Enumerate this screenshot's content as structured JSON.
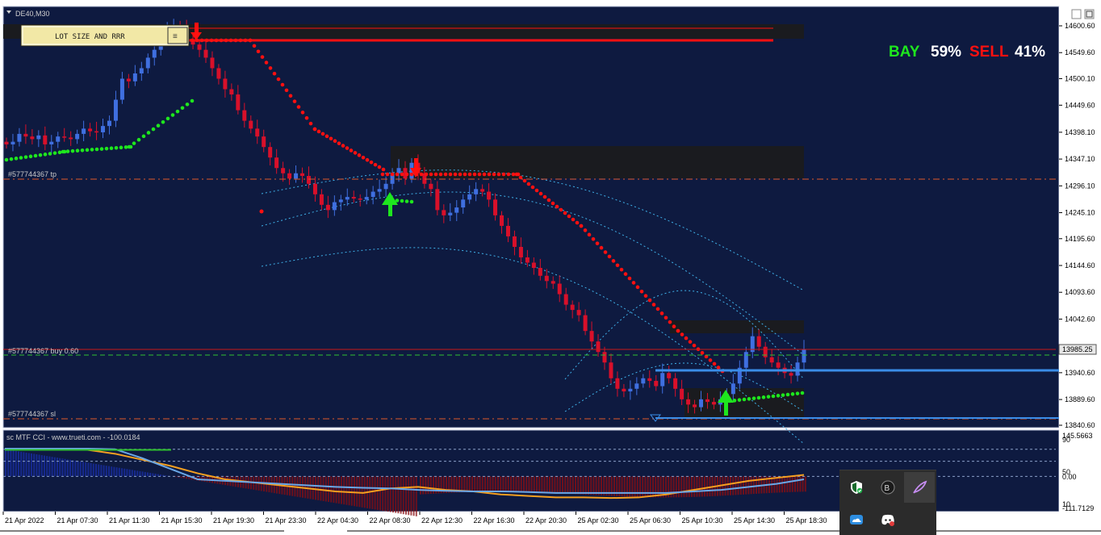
{
  "window": {
    "title": "DE40,M30"
  },
  "panel": {
    "lot_size_label": "LOT SIZE AND RRR"
  },
  "sentiment": {
    "buy_label": "BAY",
    "buy_pct": "59%",
    "sell_label": "SELL",
    "sell_pct": "41%"
  },
  "order_lines": {
    "tp": "#577744367 tp",
    "buy": "#577744367 buy 0.60",
    "sl": "#577744367 sl"
  },
  "current_price": "13985.25",
  "indicator": {
    "label": "sc MTF CCI - www.trueti.com - -100.0184"
  },
  "colors": {
    "background": "#0e1a40",
    "bull": "#3f6fe0",
    "bear": "#d8102a",
    "trail_up": "#1ee61e",
    "trail_down": "#ff1010",
    "zone": "#1c1c1c",
    "buy_text": "#1ee61e",
    "sell_text": "#ff1010"
  },
  "chart_data": [
    {
      "type": "candlestick",
      "symbol": "DE40",
      "timeframe": "M30",
      "ylim": [
        13815,
        14625
      ],
      "y_ticks": [
        "14600.60",
        "14549.60",
        "14500.10",
        "14449.60",
        "14398.10",
        "14347.10",
        "14296.10",
        "14245.10",
        "14195.60",
        "14144.60",
        "14093.60",
        "14042.60",
        "13940.60",
        "13889.60",
        "13840.60"
      ],
      "x_ticks": [
        "21 Apr 2022",
        "21 Apr 07:30",
        "21 Apr 11:30",
        "21 Apr 15:30",
        "21 Apr 19:30",
        "21 Apr 23:30",
        "22 Apr 04:30",
        "22 Apr 08:30",
        "22 Apr 12:30",
        "22 Apr 16:30",
        "22 Apr 20:30",
        "25 Apr 02:30",
        "25 Apr 06:30",
        "25 Apr 10:30",
        "25 Apr 14:30",
        "25 Apr 18:30"
      ],
      "close_approx": [
        14375,
        14380,
        14395,
        14390,
        14385,
        14392,
        14375,
        14380,
        14390,
        14388,
        14385,
        14395,
        14405,
        14400,
        14398,
        14410,
        14420,
        14460,
        14500,
        14495,
        14510,
        14520,
        14540,
        14555,
        14580,
        14590,
        14600,
        14595,
        14575,
        14565,
        14555,
        14540,
        14520,
        14500,
        14480,
        14470,
        14440,
        14420,
        14405,
        14390,
        14370,
        14350,
        14330,
        14320,
        14310,
        14320,
        14315,
        14300,
        14280,
        14260,
        14250,
        14265,
        14270,
        14275,
        14272,
        14270,
        14275,
        14285,
        14290,
        14300,
        14320,
        14330,
        14310,
        14340,
        14320,
        14300,
        14290,
        14250,
        14240,
        14245,
        14255,
        14270,
        14280,
        14290,
        14285,
        14270,
        14240,
        14220,
        14200,
        14180,
        14160,
        14150,
        14140,
        14125,
        14115,
        14110,
        14090,
        14070,
        14060,
        14050,
        14020,
        14000,
        13980,
        13960,
        13930,
        13910,
        13905,
        13910,
        13920,
        13930,
        13925,
        13915,
        13940,
        13930,
        13910,
        13890,
        13880,
        13875,
        13890,
        13885,
        13880,
        13890,
        13900,
        13920,
        13950,
        13980,
        14010,
        13990,
        13970,
        13960,
        13950,
        13940,
        13935,
        13960,
        13985
      ]
    },
    {
      "type": "line",
      "name": "sc MTF CCI",
      "ylim": [
        -111.7129,
        145.5663
      ],
      "y_ticks": [
        "145.5663",
        "90",
        "50",
        "0.00",
        "10",
        "-111.7129"
      ],
      "series": [
        {
          "values": [
            88,
            88,
            88,
            88,
            75,
            55,
            35,
            10,
            -10,
            -20,
            -30,
            -40,
            -50,
            -55,
            -40,
            -35,
            -45,
            -50,
            -60,
            -65,
            -70,
            -70,
            -72,
            -70,
            -60,
            -45,
            -30,
            -15,
            -5,
            5
          ]
        },
        {
          "values": [
            92,
            92,
            92,
            92,
            90,
            60,
            25,
            -10,
            -15,
            -20,
            -25,
            -30,
            -35,
            -38,
            -40,
            -45,
            -48,
            -50,
            -50,
            -52,
            -55,
            -55,
            -55,
            -55,
            -55,
            -50,
            -45,
            -35,
            -25,
            -10
          ]
        }
      ]
    }
  ]
}
